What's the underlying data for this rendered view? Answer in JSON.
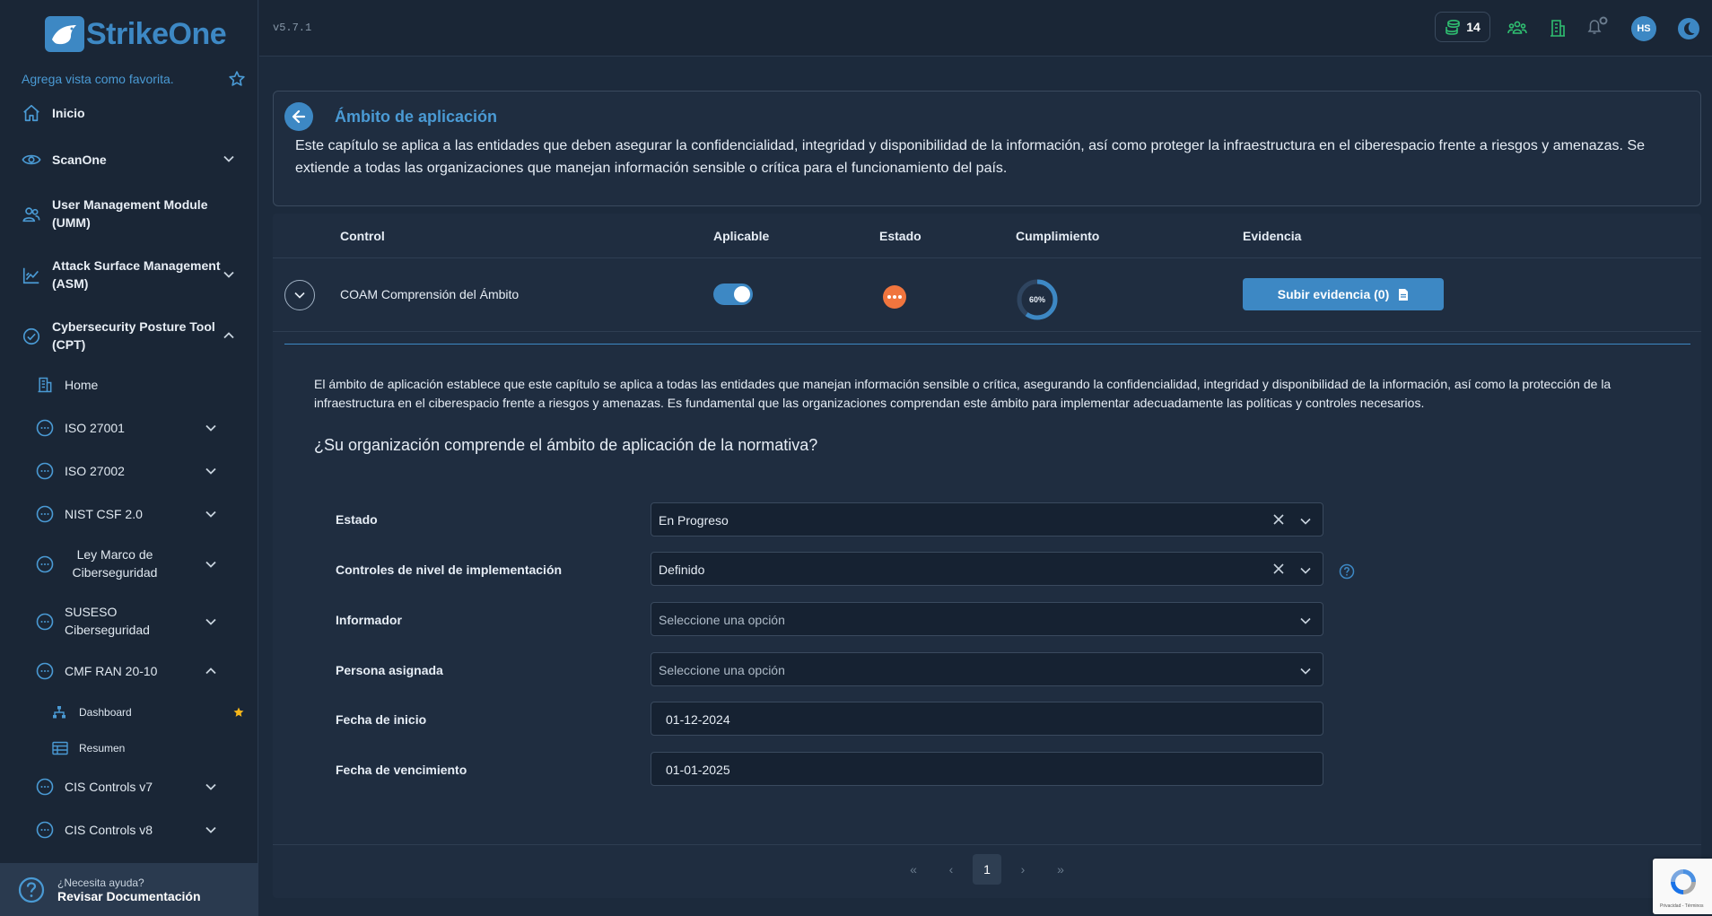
{
  "app": {
    "brand": "StrikeOne",
    "version": "v5.7.1"
  },
  "sidebar": {
    "favorite_hint": "Agrega vista como favorita.",
    "items": [
      {
        "label": "Inicio"
      },
      {
        "label": "ScanOne"
      },
      {
        "label": "User Management Module (UMM)"
      },
      {
        "label": "Attack Surface Management (ASM)"
      },
      {
        "label": "Cybersecurity Posture Tool (CPT)"
      }
    ],
    "cpt_children": [
      {
        "label": "Home"
      },
      {
        "label": "ISO 27001"
      },
      {
        "label": "ISO 27002"
      },
      {
        "label": "NIST CSF 2.0"
      },
      {
        "label": "Ley Marco de Ciberseguridad"
      },
      {
        "label": "SUSESO Ciberseguridad"
      },
      {
        "label": "CMF RAN 20-10"
      },
      {
        "label": "CIS Controls v7"
      },
      {
        "label": "CIS Controls v8"
      }
    ],
    "cmf_children": [
      {
        "label": "Dashboard",
        "favorite": true
      },
      {
        "label": "Resumen"
      }
    ],
    "help": {
      "question": "¿Necesita ayuda?",
      "link": "Revisar Documentación"
    }
  },
  "topbar": {
    "credits": "14",
    "avatar_initials": "HS"
  },
  "scope": {
    "title": "Ámbito de aplicación",
    "description": "Este capítulo se aplica a las entidades que deben asegurar la confidencialidad, integridad y disponibilidad de la información, así como proteger la infraestructura en el ciberespacio frente a riesgos y amenazas. Se extiende a todas las organizaciones que manejan información sensible o crítica para el funcionamiento del país."
  },
  "table": {
    "headers": {
      "control": "Control",
      "aplicable": "Aplicable",
      "estado": "Estado",
      "cumplimiento": "Cumplimiento",
      "evidencia": "Evidencia"
    },
    "row": {
      "control": "COAM Comprensión del Ámbito",
      "aplicable": true,
      "estado_icon": "more-dots-icon",
      "cumplimiento_pct": 60,
      "cumplimiento_label": "60%",
      "evidence_button": "Subir evidencia (0)"
    }
  },
  "detail": {
    "text": "El ámbito de aplicación establece que este capítulo se aplica a todas las entidades que manejan información sensible o crítica, asegurando la confidencialidad, integridad y disponibilidad de la información, así como la protección de la infraestructura en el ciberespacio frente a riesgos y amenazas. Es fundamental que las organizaciones comprendan este ámbito para implementar adecuadamente las políticas y controles necesarios.",
    "question": "¿Su organización comprende el ámbito de aplicación de la normativa?",
    "form": {
      "estado": {
        "label": "Estado",
        "value": "En Progreso"
      },
      "nivel": {
        "label": "Controles de nivel de implementación",
        "value": "Definido"
      },
      "informador": {
        "label": "Informador",
        "placeholder": "Seleccione una opción"
      },
      "asignada": {
        "label": "Persona asignada",
        "placeholder": "Seleccione una opción"
      },
      "inicio": {
        "label": "Fecha de inicio",
        "value": "01-12-2024"
      },
      "vencimiento": {
        "label": "Fecha de vencimiento",
        "value": "01-01-2025"
      }
    }
  },
  "pagination": {
    "first": "«",
    "prev": "‹",
    "current": "1",
    "next": "›",
    "last": "»"
  },
  "recaptcha": {
    "text": "Privacidad - Términos"
  },
  "colors": {
    "accent": "#3d88c4",
    "estado_in_progress": "#f0753e",
    "background": "#1c2a3c"
  }
}
